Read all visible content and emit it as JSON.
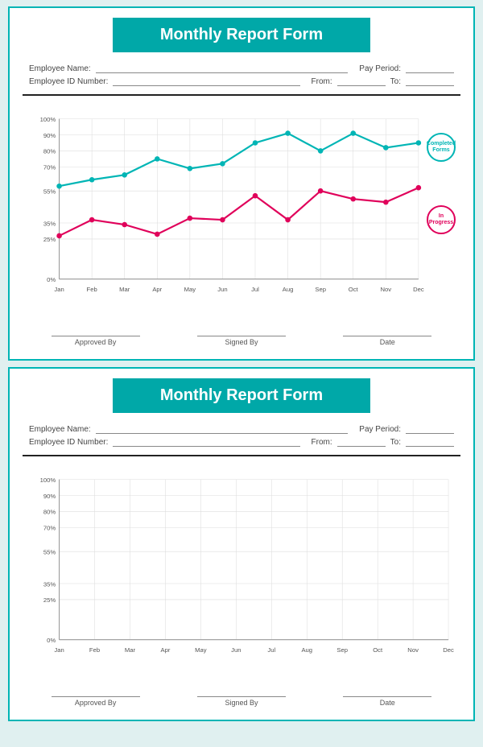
{
  "cards": [
    {
      "id": "card-1",
      "title": "Monthly Report Form",
      "fields": {
        "employee_name_label": "Employee Name:",
        "pay_period_label": "Pay Period:",
        "employee_id_label": "Employee ID Number:",
        "from_label": "From:",
        "to_label": "To:"
      },
      "chart": {
        "y_labels": [
          "100%",
          "90%",
          "80%",
          "70%",
          "55%",
          "35%",
          "25%",
          "0%"
        ],
        "x_labels": [
          "Jan",
          "Feb",
          "Mar",
          "Apr",
          "May",
          "Jun",
          "Jul",
          "Aug",
          "Sep",
          "Oct",
          "Nov",
          "Dec"
        ],
        "completed_series": [
          58,
          62,
          65,
          75,
          69,
          72,
          85,
          91,
          80,
          91,
          82,
          85
        ],
        "inprogress_series": [
          27,
          37,
          34,
          28,
          38,
          37,
          52,
          37,
          55,
          50,
          48,
          57
        ],
        "legend_completed": "Completed Forms",
        "legend_inprogress": "In Progress"
      },
      "signatures": [
        "Approved By",
        "Signed By",
        "Date"
      ]
    },
    {
      "id": "card-2",
      "title": "Monthly Report Form",
      "fields": {
        "employee_name_label": "Employee Name:",
        "pay_period_label": "Pay Period:",
        "employee_id_label": "Employee ID Number:",
        "from_label": "From:",
        "to_label": "To:"
      },
      "chart": {
        "y_labels": [
          "100%",
          "90%",
          "80%",
          "70%",
          "55%",
          "35%",
          "25%",
          "0%"
        ],
        "x_labels": [
          "Jan",
          "Feb",
          "Mar",
          "Apr",
          "May",
          "Jun",
          "Jul",
          "Aug",
          "Sep",
          "Oct",
          "Nov",
          "Dec"
        ],
        "completed_series": [],
        "inprogress_series": [],
        "legend_completed": "",
        "legend_inprogress": ""
      },
      "signatures": [
        "Approved By",
        "Signed By",
        "Date"
      ]
    }
  ]
}
